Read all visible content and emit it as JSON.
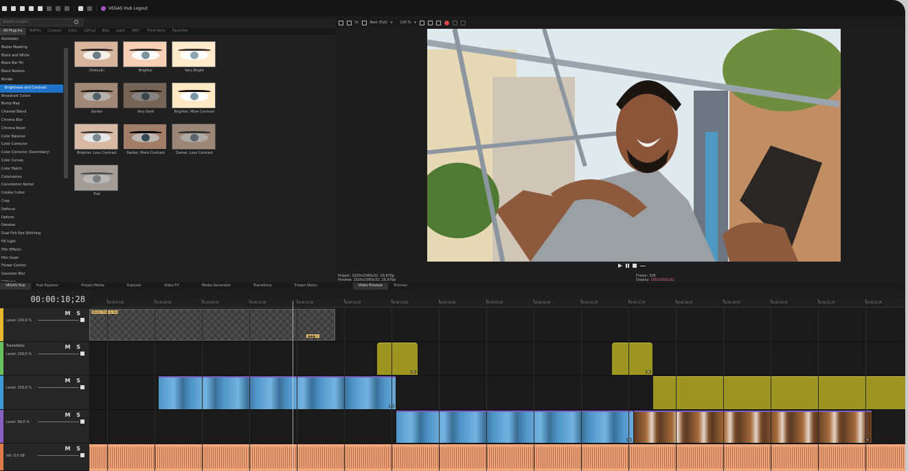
{
  "titlebar": {
    "hub_label": "VEGAS Hub Logout"
  },
  "plugins": {
    "search_placeholder": "Search plugins",
    "categories": [
      "All Plug-ins",
      "HitFilm",
      "Cookies",
      "Color",
      "LSPlug",
      "Blur",
      "Light",
      "360°",
      "Third Party",
      "Favorites"
    ],
    "items": [
      "Autolooks",
      "Bezier Masking",
      "Black and White",
      "Black Bar Fill",
      "Black Restore",
      "Border",
      "Brightness and Contrast",
      "Broadcast Colors",
      "Bump Map",
      "Channel Blend",
      "Chroma Blur",
      "Chroma Keyer",
      "Color Balance",
      "Color Corrector",
      "Color Corrector (Secondary)",
      "Color Curves",
      "Color Match",
      "Colorization",
      "Convolution Kernel",
      "Cookie Cutter",
      "Crop",
      "Defocus",
      "Deform",
      "Denoise",
      "Dual Fish Eye Stitching",
      "Fill Light",
      "Film Effects",
      "Film Grain",
      "Flicker Control",
      "Gaussian Blur",
      "Glitterer"
    ],
    "selected": "Brightness and Contrast",
    "presets": [
      "(Default)",
      "Brighter",
      "Very Bright",
      "Darker",
      "Very Dark",
      "Brighter, More Contrast",
      "Brighter, Less Contrast",
      "Darker, More Contrast",
      "Darker, Less Contrast",
      "Flat"
    ]
  },
  "preview": {
    "quality": "Best (Full)",
    "zoom": "120 %",
    "project_line": "Project:  1920x1080x32; 29,970p",
    "preview_line": "Preview:  1920x1080x32; 29,970p",
    "frame_label": "Frame:",
    "frame_value": "328",
    "display_label": "Display:",
    "display_value": "1052x592x32"
  },
  "tabs": [
    "VEGAS Hub",
    "Hub Explorer",
    "Project Media",
    "Explorer",
    "Video FX",
    "Media Generator",
    "Transitions",
    "Project Notes",
    "Video Preview",
    "Trimmer"
  ],
  "timeline": {
    "timecode": "00:00:10;28",
    "ruler": [
      "00:00:07;00",
      "00:00:08;00",
      "00:00:09;00",
      "00:00:10;00",
      "00:00:11;00",
      "00:00:12;00",
      "00:00:13;00",
      "00:00:14;00",
      "00:00:15;00",
      "00:00:16;00",
      "00:00:16;29",
      "00:00:17;29",
      "00:00:18;29",
      "00:00:19;29",
      "00:00:20;29",
      "00:00:21;29",
      "00:00:22;29"
    ],
    "tracks": [
      {
        "name": "",
        "level": "Level: 100,0 %",
        "color": "#e6b52e"
      },
      {
        "name": "Transitions",
        "level": "Level: 100,0 %",
        "color": "#67c25e"
      },
      {
        "name": "",
        "level": "Level: 100,0 %",
        "color": "#3e9bd5"
      },
      {
        "name": "",
        "level": "Level: 99,0 %",
        "color": "#8a5fc4"
      },
      {
        "name": "",
        "level": "Vol:      0,0 dB",
        "color": "#e07a4a"
      }
    ],
    "ms": "M S",
    "title_clip": "VEGAS Titles & Text",
    "fx": "fx"
  },
  "colors": {
    "accent": "#1f73c9",
    "hub": "#a552c6",
    "audio": "#f0a57a",
    "yellow_clip": "#9d9522"
  }
}
